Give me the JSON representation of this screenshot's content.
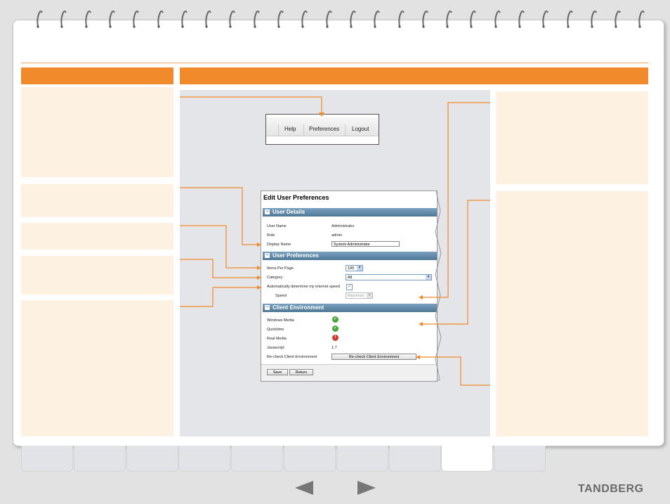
{
  "menu": {
    "items": [
      "Help",
      "Preferences",
      "Logout"
    ]
  },
  "form": {
    "title": "Edit User Preferences",
    "sections": {
      "user_details": "User Details",
      "user_preferences": "User Preferences",
      "client_environment": "Client Environment"
    },
    "user_details": {
      "user_name_label": "User Name",
      "user_name_value": "Administrator",
      "role_label": "Role",
      "role_value": "admin",
      "display_name_label": "Display Name",
      "display_name_value": "System Administrator"
    },
    "preferences": {
      "items_per_page_label": "Items Per Page",
      "items_per_page_value": "100",
      "category_label": "Category",
      "category_value": "All",
      "auto_speed_label": "Automatically determine my internet speed",
      "speed_label": "Speed",
      "speed_value": "Maximum"
    },
    "client_env": {
      "windows_media_label": "Windows Media",
      "quicktime_label": "Quicktime",
      "real_media_label": "Real Media",
      "javascript_label": "Javascript",
      "javascript_value": "1.7",
      "recheck_label": "Re-check Client Environment",
      "recheck_button": "Re-check Client Environment"
    },
    "buttons": {
      "save": "Save",
      "return": "Return"
    }
  },
  "footer": {
    "logo": "TANDBERG"
  },
  "colors": {
    "accent": "#f18a2a",
    "cream": "#fdf2e2",
    "section_blue": "#5a84a4"
  }
}
